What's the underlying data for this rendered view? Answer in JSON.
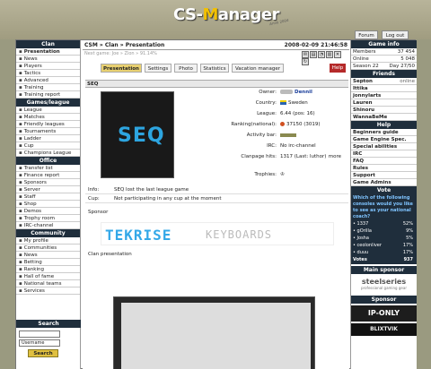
{
  "header": {
    "logo_a": "CS-",
    "logo_b": "M",
    "logo_c": "anager",
    "stamp": "Anno 2004"
  },
  "top_buttons": {
    "forum": "Forum",
    "logout": "Log out"
  },
  "left": {
    "clan_title": "Clan",
    "clan_items": [
      "Presentation",
      "News",
      "Players",
      "Tactics",
      "Advanced",
      "Training",
      "Training report"
    ],
    "games_title": "Games/league",
    "games_items": [
      "League",
      "Matches",
      "Friendly leagues",
      "Tournaments",
      "Ladder",
      "Cup",
      "Champions League"
    ],
    "office_title": "Office",
    "office_items": [
      "Transfer list",
      "Finance report",
      "Sponsors",
      "Server",
      "Staff",
      "Shop",
      "Demos",
      "Trophy room",
      "IRC-channel"
    ],
    "community_title": "Community",
    "community_items": [
      "My profile",
      "Communities",
      "News",
      "Betting",
      "Ranking",
      "Hall of fame",
      "National teams",
      "Services"
    ],
    "search_title": "Search",
    "search_select": "Username",
    "search_button": "Search"
  },
  "main": {
    "breadcrumb": "CSM » Clan » Presentation",
    "datetime": "2008-02-09 21:46:58",
    "location": "Next game: Joe » Zion » 91.14%",
    "tabs": [
      "Presentation",
      "Settings",
      "Photo",
      "Statistics",
      "Vacation manager"
    ],
    "help": "Help",
    "clan_name": "SEQ",
    "logo_text": "SEQ",
    "info": [
      {
        "k": "Owner:",
        "v": "Dennil"
      },
      {
        "k": "Country:",
        "v": "Sweden"
      },
      {
        "k": "League:",
        "v": "6.44 (pos: 16)"
      },
      {
        "k": "Ranking(national):",
        "v": "37150 (3019)"
      },
      {
        "k": "Activity bar:",
        "v": ""
      },
      {
        "k": "IRC:",
        "v": "No irc-channel"
      },
      {
        "k": "Clanpage hits:",
        "v": "1317 (Last: luthor)"
      },
      {
        "k": "Trophies:",
        "v": ""
      }
    ],
    "more": "more",
    "info_label": "Info:",
    "info_value": "SEQ lost the last league game",
    "cup_label": "Cup:",
    "cup_value": "Not participating in any cup at the moment",
    "sponsor_title": "Sponsor",
    "sponsor_a": "TEKRISE",
    "sponsor_b": "KEYBOARDS",
    "presentation_title": "Clan presentation"
  },
  "right": {
    "gameinfo_title": "Game info",
    "gameinfo": [
      {
        "k": "Members",
        "v": "37 454"
      },
      {
        "k": "Online",
        "v": "5 048"
      },
      {
        "k": "Season 22",
        "v": "Day 27/50"
      }
    ],
    "friends_title": "Friends",
    "friends": [
      {
        "k": "Septon",
        "v": "online"
      },
      {
        "k": "Ittika",
        "v": ""
      },
      {
        "k": "jonnylarts",
        "v": ""
      },
      {
        "k": "Lauren",
        "v": ""
      },
      {
        "k": "Shinoru",
        "v": ""
      },
      {
        "k": "WannaBeMe",
        "v": ""
      }
    ],
    "help_title": "Help",
    "help_items": [
      "Beginners guide",
      "Game Engine Spec.",
      "Special abilities",
      "IRC",
      "FAQ",
      "Rules",
      "Support",
      "Game Admins"
    ],
    "vote_title": "Vote",
    "vote_q": "Which of the following consoles would you like to see as your national coach?",
    "vote_opts": [
      {
        "k": "1337",
        "v": "52%"
      },
      {
        "k": "gOrilla",
        "v": "9%"
      },
      {
        "k": "Josha",
        "v": "5%"
      },
      {
        "k": "ceolonliver",
        "v": "17%"
      },
      {
        "k": "duuu",
        "v": "17%"
      }
    ],
    "votes_label": "Votes",
    "votes_value": "937",
    "mainsponsor_title": "Main sponsor",
    "mainsponsor": "steelseries",
    "mainsponsor_sub": "professional gaming gear",
    "sponsor_title": "Sponsor",
    "sponsor1": "IP-ONLY",
    "sponsor2": "BLIXTVIK"
  }
}
